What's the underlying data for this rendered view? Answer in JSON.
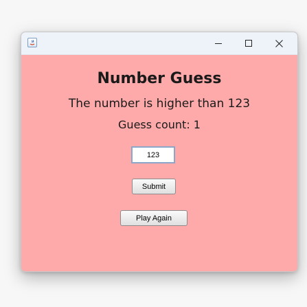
{
  "window": {
    "icon": "java-app-icon",
    "controls": {
      "minimize": "minimize-icon",
      "maximize": "maximize-icon",
      "close": "close-icon"
    }
  },
  "game": {
    "title": "Number Guess",
    "hint": "The number is higher than 123",
    "guess_count": "Guess count: 1",
    "input_value": "123",
    "submit_label": "Submit",
    "play_again_label": "Play Again"
  },
  "colors": {
    "background": "#ffaaaa",
    "titlebar": "#eef2f9"
  }
}
